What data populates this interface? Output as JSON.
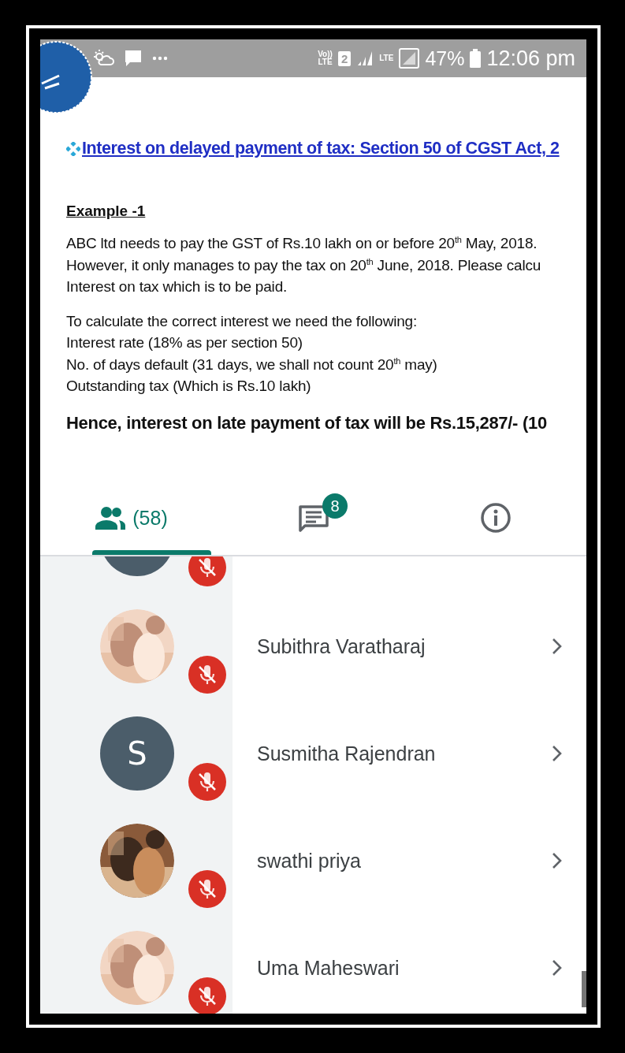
{
  "status_bar": {
    "battery": "47%",
    "time": "12:06 pm",
    "sim": "2",
    "volte": "Vo))",
    "volte_lte": "LTE",
    "lte": "LTE"
  },
  "slide": {
    "title": "Interest on delayed payment of tax: Section 50 of CGST Act, 2",
    "example": "Example -1",
    "paragraph_1": [
      "ABC ltd needs to pay the GST of Rs.10 lakh on or before 20$^{th}$ May, 2018.",
      "However, it only manages to pay the tax on 20$^{th}$ June, 2018. Please calcu",
      "Interest on tax which is to be paid."
    ],
    "paragraph_2": [
      "To calculate the correct interest we need the following:",
      "Interest rate (18% as per section 50)",
      "No. of days default (31 days, we shall not count 20$^{th}$ may)",
      "Outstanding tax (Which is Rs.10 lakh)"
    ],
    "conclusion": "Hence, interest on late payment of tax will be Rs.15,287/- (10"
  },
  "tabs": [
    {
      "kind": "people",
      "label": "(58)",
      "selected": true
    },
    {
      "kind": "chat",
      "badge": "8",
      "selected": false
    },
    {
      "kind": "info",
      "selected": false
    }
  ],
  "participants": [
    {
      "avatar": {
        "kind": "letter"
      },
      "muted": true
    },
    {
      "name": "Subithra Varatharaj",
      "muted": true
    },
    {
      "name": "Susmitha Rajendran",
      "avatar": {
        "kind": "letter",
        "letter": "S"
      },
      "muted": true
    },
    {
      "name": "swathi priya",
      "muted": true
    },
    {
      "name": "Uma Maheswari",
      "muted": true
    }
  ]
}
